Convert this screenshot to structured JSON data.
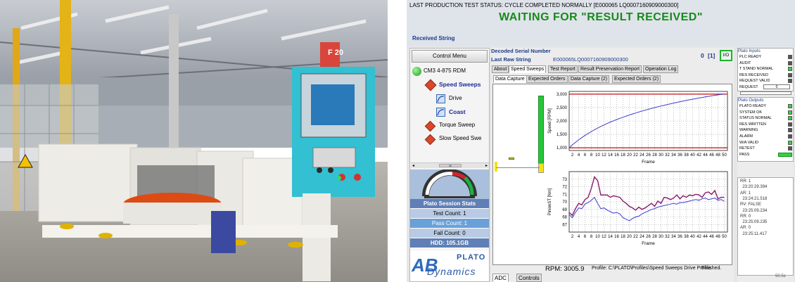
{
  "photo": {
    "sign_text": "F 20"
  },
  "header": {
    "status_line": "LAST PRODUCTION TEST STATUS: CYCLE COMPLETED NORMALLY  [E000065 LQ0007160909000300]",
    "waiting": "WAITING FOR \"RESULT RECEIVED\"",
    "received_label": "Received String"
  },
  "left": {
    "control_menu": "Control Menu",
    "tree": [
      {
        "label": "CM3 4-875 RDM",
        "bold": false
      },
      {
        "label": "Speed Sweeps",
        "bold": true
      },
      {
        "label": "Drive",
        "bold": false
      },
      {
        "label": "Coast",
        "bold": true
      },
      {
        "label": "Torque Sweep",
        "bold": false
      },
      {
        "label": "Slow Speed Swe",
        "bold": false
      }
    ],
    "scroll_thumb": "III",
    "stats_title": "Plato Session Stats",
    "test_count": "Test Count: 1",
    "pass_count": "Pass Count: 1",
    "fail_count": "Fail Count: 0",
    "hdd": "HDD: 105.1GB",
    "logo_plato": "PLATO",
    "logo_dynamics": "Dynamics",
    "logo_ab": "AB"
  },
  "main": {
    "decoded_label": "Decoded Serial Number",
    "raw_label": "Last Raw String",
    "raw_value": "E000065LQ0007160909000300",
    "counter": "0",
    "counter_bracket": "[1]",
    "io_button": "I/O",
    "tabs_top": [
      "About",
      "Speed Sweeps",
      "Test Report",
      "Result Preservation Report",
      "Operation Log"
    ],
    "tabs_sub": [
      "Data Capture",
      "Expected Orders",
      "Data Capture (2)",
      "Expected Orders (2)"
    ],
    "rpm": "RPM: 3005.9",
    "profile": "Profile: C:\\PLATO\\Profiles\\Speed Sweeps Drive Profile",
    "finished": "Finished.",
    "bottom_tabs": [
      "ADC",
      "Controls"
    ]
  },
  "chart_data": [
    {
      "type": "line",
      "title": "",
      "xlabel": "Frame",
      "ylabel": "Speed [RPM]",
      "xlim": [
        1,
        51
      ],
      "ylim": [
        900,
        3100
      ],
      "yticks": [
        1000,
        1500,
        2000,
        2500,
        3000
      ],
      "ytick_labels": [
        "1,000",
        "1,500",
        "2,000",
        "2,500",
        "3,000"
      ],
      "xticks": [
        2,
        4,
        6,
        8,
        10,
        12,
        14,
        16,
        18,
        20,
        22,
        24,
        26,
        28,
        30,
        32,
        34,
        36,
        38,
        40,
        42,
        44,
        46,
        48,
        50
      ],
      "grid": true,
      "limits": [
        1000,
        3000
      ],
      "series": [
        {
          "values": [
            1000,
            1110,
            1205,
            1295,
            1380,
            1460,
            1535,
            1605,
            1672,
            1735,
            1795,
            1852,
            1905,
            1957,
            2005,
            2052,
            2097,
            2140,
            2182,
            2222,
            2260,
            2297,
            2333,
            2368,
            2402,
            2435,
            2467,
            2498,
            2528,
            2557,
            2585,
            2613,
            2640,
            2666,
            2692,
            2717,
            2741,
            2765,
            2788,
            2810,
            2832,
            2854,
            2875,
            2895,
            2915,
            2935,
            2954,
            2972,
            2990,
            3005
          ]
        }
      ],
      "colors": {
        "series": "#3c3ccc",
        "limit": "#cc2020"
      }
    },
    {
      "type": "line",
      "title": "",
      "xlabel": "Frame",
      "ylabel": "PinionST [Nm]",
      "xlim": [
        1,
        51
      ],
      "ylim": [
        66,
        74
      ],
      "yticks": [
        67,
        68,
        69,
        70,
        71,
        72,
        73
      ],
      "xticks": [
        2,
        4,
        6,
        8,
        10,
        12,
        14,
        16,
        18,
        20,
        22,
        24,
        26,
        28,
        30,
        32,
        34,
        36,
        38,
        40,
        42,
        44,
        46,
        48,
        50
      ],
      "grid": true,
      "series": [
        {
          "values": [
            68.6,
            68.2,
            69.1,
            69.8,
            69.6,
            70.3,
            70.6,
            71.8,
            73.3,
            72.8,
            70.9,
            70.9,
            70.9,
            70.6,
            70.8,
            70.7,
            70.6,
            70.1,
            69.8,
            69.4,
            69.2,
            68.9,
            69.3,
            69.0,
            69.2,
            69.5,
            69.8,
            69.4,
            70.1,
            69.8,
            70.6,
            70.5,
            70.3,
            70.5,
            70.9,
            70.4,
            70.8,
            70.6,
            70.9,
            70.8,
            71.0,
            70.9,
            70.6,
            71.2,
            71.3,
            71.0,
            71.5,
            70.4,
            70.6,
            70.6
          ]
        },
        {
          "values": [
            68.3,
            67.9,
            68.6,
            69.2,
            69.1,
            69.7,
            69.9,
            70.2,
            70.6,
            69.8,
            69.1,
            69.2,
            68.9,
            68.7,
            68.5,
            68.6,
            68.4,
            67.9,
            67.7,
            67.5,
            67.8,
            68.0,
            68.1,
            68.4,
            68.6,
            68.8,
            69.0,
            69.1,
            69.3,
            69.4,
            69.5,
            69.6,
            69.7,
            69.8,
            69.7,
            69.9,
            69.9,
            70.0,
            70.1,
            70.2,
            70.3,
            70.2,
            70.4,
            70.5,
            70.3,
            70.4,
            70.5,
            70.2,
            70.3,
            70.1
          ]
        }
      ],
      "colors": {
        "series0": "#8a1a6a",
        "series1": "#3c3ccc"
      }
    }
  ],
  "plato_inputs": {
    "title": "Plato Inputs",
    "items": [
      {
        "label": "PLC READY",
        "on": false
      },
      {
        "label": "AUDIT",
        "on": false
      },
      {
        "label": "T STAND NORMAL",
        "on": true
      },
      {
        "label": "RES RECEIVED",
        "on": false
      },
      {
        "label": "REQUEST VALID",
        "on": false
      },
      {
        "label": "REQUEST",
        "on": false
      }
    ],
    "request_value": "0"
  },
  "plato_outputs": {
    "title": "Plato Outputs",
    "items": [
      {
        "label": "PLATO READY",
        "on": true
      },
      {
        "label": "SYSTEM OK",
        "on": true
      },
      {
        "label": "STATUS NORMAL",
        "on": true
      },
      {
        "label": "RES WRITTEN",
        "on": false
      },
      {
        "label": "WARNING",
        "on": false
      },
      {
        "label": "ALARM",
        "on": false
      },
      {
        "label": "W/A VALID",
        "on": true
      },
      {
        "label": "RETEST",
        "on": false
      },
      {
        "label": "PASS",
        "on": true
      }
    ]
  },
  "log": [
    "RR: 1",
    "  23:20:29.394",
    "AR: 1",
    "  23:24:21.518",
    "RV: FALSE",
    "  23:25:09.234",
    "RR: 0",
    "  23:25:09.235",
    "AR: 0",
    "  23:25:11.417"
  ],
  "elapsed": "50.5s"
}
